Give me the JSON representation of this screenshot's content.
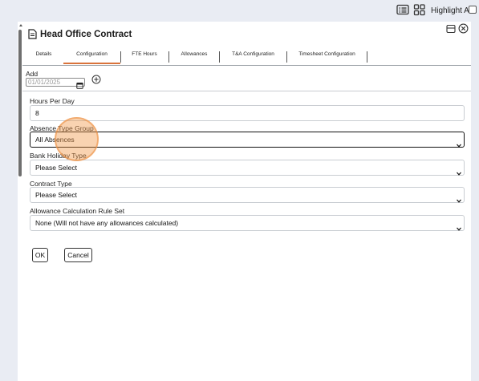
{
  "topbar": {
    "list_icon": "list-view-icon",
    "grid_icon": "grid-view-icon",
    "highlight_all_label": "Highlight All"
  },
  "dialog": {
    "title": "Head Office Contract",
    "doc_icon": "document-icon",
    "restore_icon": "window-restore-icon",
    "close_icon": "close-circle-icon"
  },
  "tabs": [
    {
      "label": "Details",
      "selected": false
    },
    {
      "label": "Configuration",
      "selected": true
    },
    {
      "label": "FTE Hours",
      "selected": false
    },
    {
      "label": "Allowances",
      "selected": false
    },
    {
      "label": "T&A Configuration",
      "selected": false
    },
    {
      "label": "Timesheet Configuration",
      "selected": false
    }
  ],
  "add_section": {
    "label": "Add",
    "date_value": "01/01/2025",
    "calendar_icon": "calendar-icon",
    "add_icon": "add-circle-icon"
  },
  "fields": {
    "hours_per_day": {
      "label": "Hours Per Day",
      "value": "8"
    },
    "absence_type_group": {
      "label": "Absence Type Group",
      "value": "All Absences"
    },
    "bank_holiday_type": {
      "label": "Bank Holiday Type",
      "value": "Please Select"
    },
    "contract_type": {
      "label": "Contract Type",
      "value": "Please Select"
    },
    "allowance_rule_set": {
      "label": "Allowance Calculation Rule Set",
      "value": "None (Will not have any allowances calculated)"
    }
  },
  "buttons": {
    "ok": "OK",
    "cancel": "Cancel"
  },
  "colors": {
    "accent": "#d9733b",
    "highlight": "#f0a060",
    "background": "#e9ecf3"
  }
}
